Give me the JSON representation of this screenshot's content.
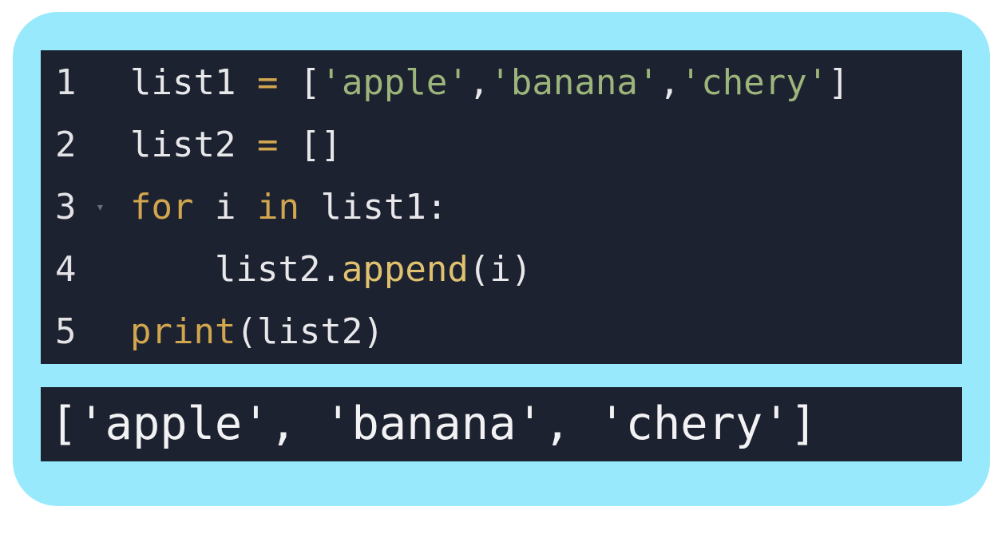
{
  "editor": {
    "lines": [
      {
        "number": "1",
        "tokens": [
          "list1",
          " ",
          "=",
          " ",
          "[",
          "'apple'",
          ",",
          "'banana'",
          ",",
          "'chery'",
          "]"
        ]
      },
      {
        "number": "2",
        "tokens": [
          "list2",
          " ",
          "=",
          " ",
          "[]"
        ]
      },
      {
        "number": "3",
        "fold_icon": "▾",
        "tokens": [
          "for",
          " i ",
          "in",
          " list1:"
        ]
      },
      {
        "number": "4",
        "tokens": [
          "    list2.",
          "append",
          "(i)"
        ]
      },
      {
        "number": "5",
        "tokens": [
          "print",
          "(list2)"
        ]
      }
    ]
  },
  "output": {
    "text": "['apple', 'banana', 'chery']"
  },
  "colors": {
    "frame": "#98e9fc",
    "editor_background": "#1d2231",
    "keyword": "#d2a64f",
    "string": "#9cb57a",
    "function": "#e0c26e",
    "text": "#e8e8ea"
  }
}
